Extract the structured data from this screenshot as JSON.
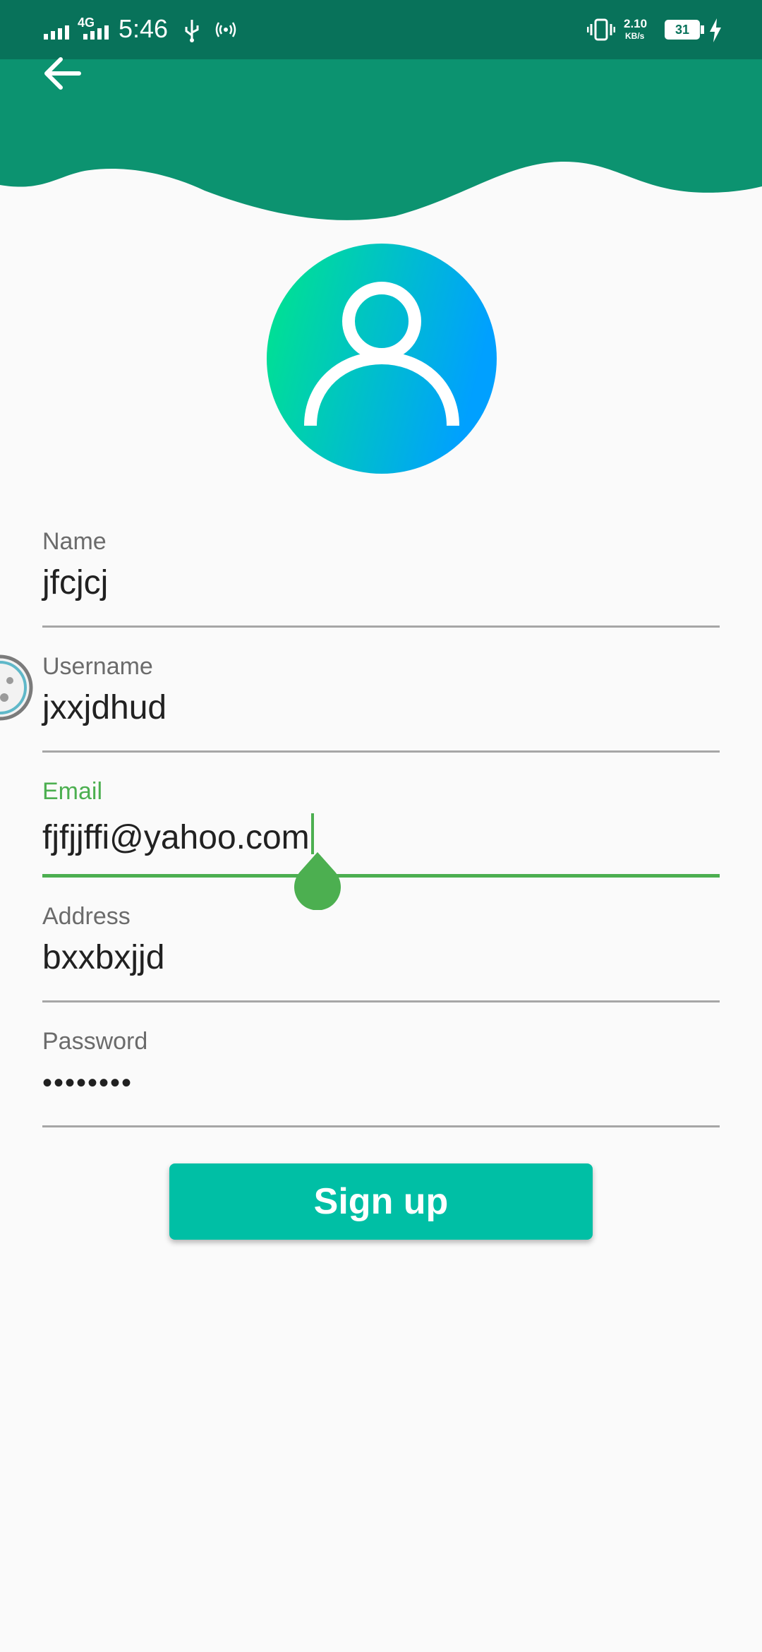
{
  "status_bar": {
    "network_label": "4G",
    "time": "5:46",
    "speed_value": "2.10",
    "speed_unit": "KB/s",
    "battery_level": "31",
    "icons": [
      "signal-icon",
      "signal-4g-icon",
      "usb-icon",
      "hotspot-icon",
      "vibrate-icon",
      "battery-icon",
      "charging-icon"
    ]
  },
  "header": {
    "back_icon": "arrow-left-icon",
    "colors": {
      "bar": "#08725a",
      "wave": "#0c9370"
    }
  },
  "avatar": {
    "icon": "user-icon",
    "gradient": [
      "#00e68a",
      "#00a0ff"
    ]
  },
  "form": {
    "name": {
      "label": "Name",
      "value": "jfcjcj"
    },
    "username": {
      "label": "Username",
      "value": "jxxjdhud"
    },
    "email": {
      "label": "Email",
      "value": "fjfjjffi@yahoo.com"
    },
    "address": {
      "label": "Address",
      "value": "bxxbxjjd"
    },
    "password": {
      "label": "Password",
      "value": "••••••••"
    },
    "accent_color": "#4caf50"
  },
  "signup_button": {
    "label": "Sign up",
    "color": "#00bfa5"
  }
}
